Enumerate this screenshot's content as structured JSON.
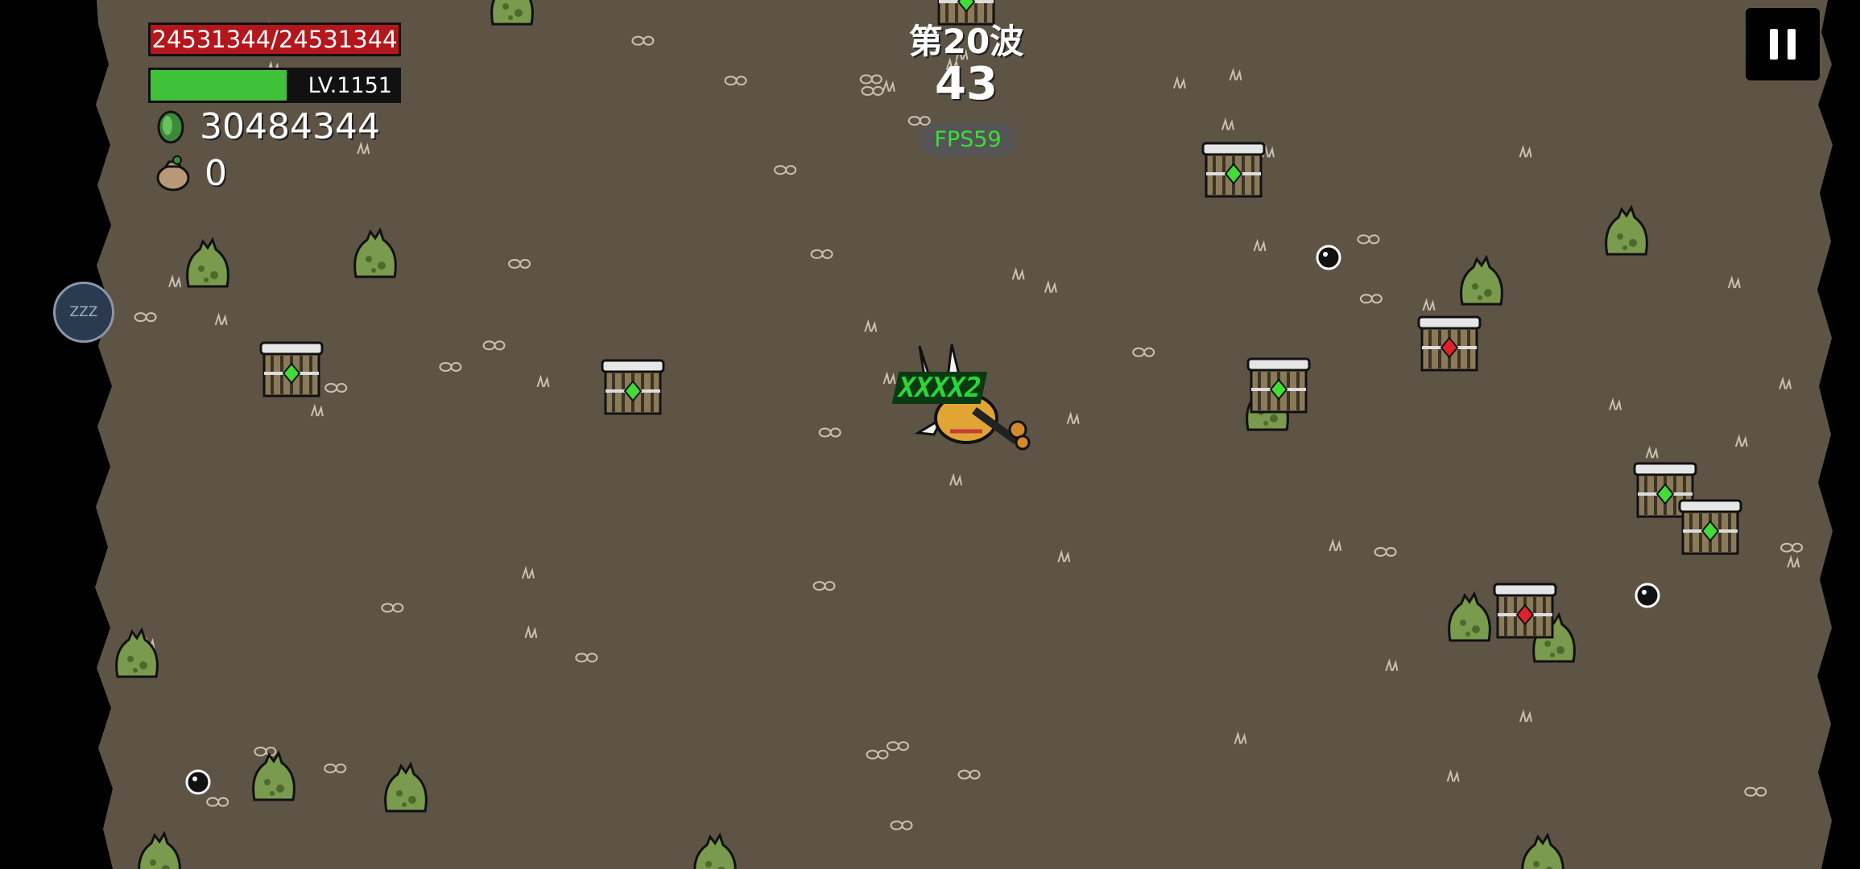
{
  "hud": {
    "hp_text": "24531344/24531344",
    "level_text": "LV.1151",
    "level_progress": 0.55,
    "coins": "30484344",
    "bags": "0",
    "wave_title": "第20波",
    "timer": "43",
    "fps": "FPS59",
    "joystick_label": "ZZZ",
    "damage_text": "XXXX2"
  },
  "colors": {
    "ground": "#5e5446",
    "hp": "#b3171c",
    "xp": "#3fc139",
    "enemy": "#7a9a4e",
    "gem_green": "#3fdc3a",
    "gem_red": "#e0202a"
  }
}
